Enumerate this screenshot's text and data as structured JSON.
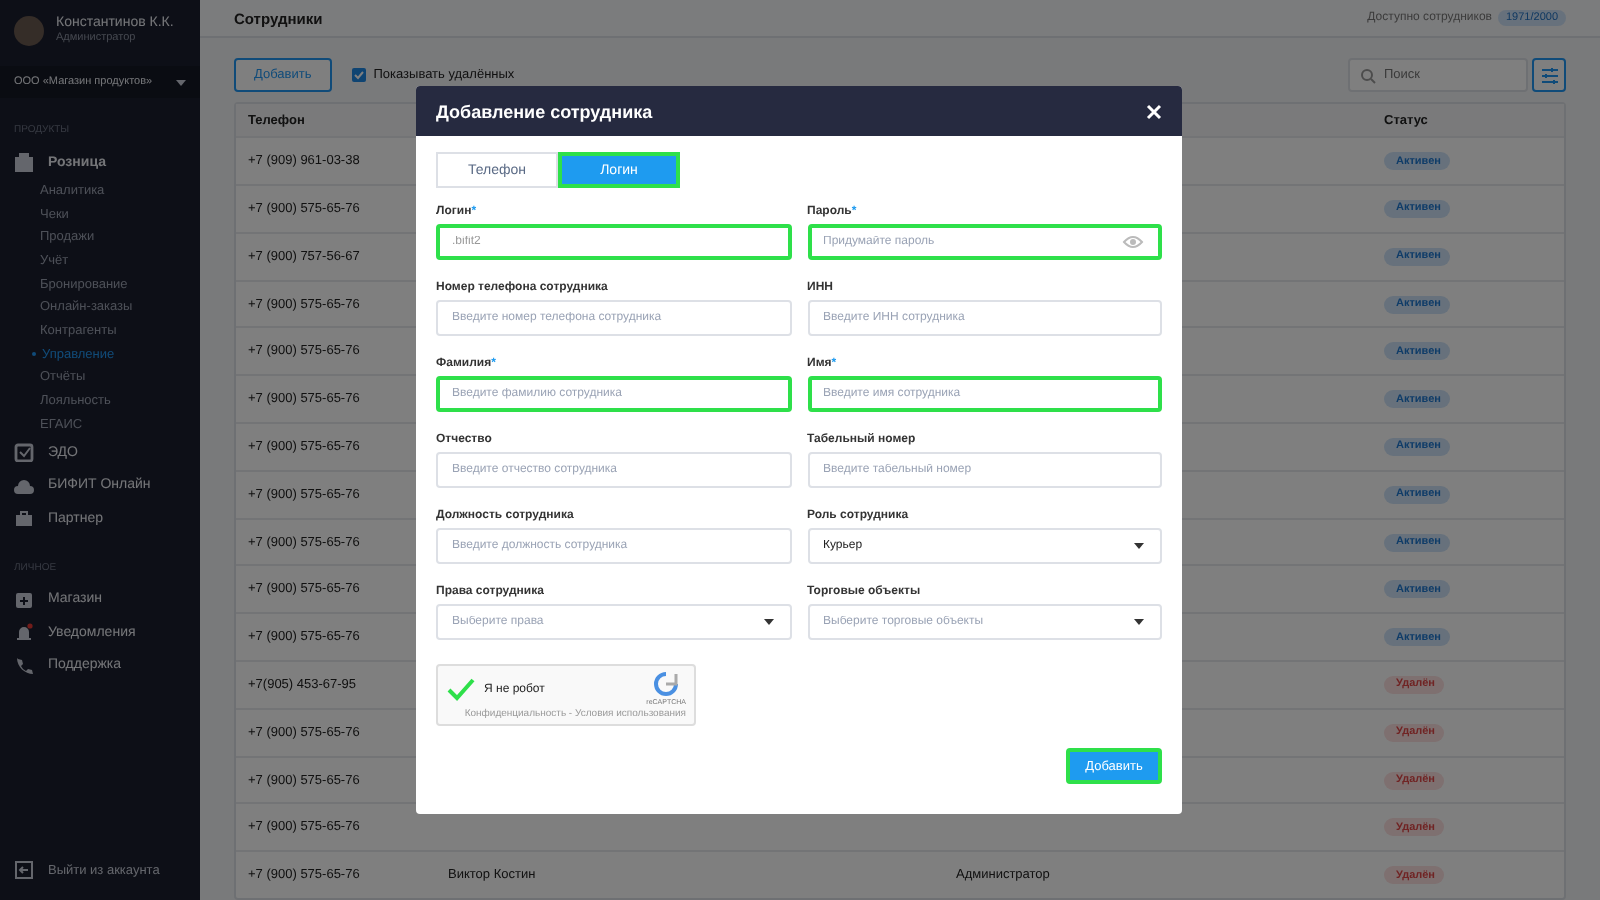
{
  "sidebar": {
    "user": {
      "name": "Константинов К.К.",
      "role": "Администратор"
    },
    "company": "ООО «Магазин продуктов»",
    "sections": [
      {
        "title": "ПРОДУКТЫ",
        "items": [
          {
            "label": "Розница",
            "expanded": true,
            "children": [
              {
                "label": "Аналитика",
                "selected": false
              },
              {
                "label": "Чеки",
                "selected": false
              },
              {
                "label": "Продажи",
                "selected": false
              },
              {
                "label": "Учёт",
                "selected": false
              },
              {
                "label": "Бронирование",
                "selected": false
              },
              {
                "label": "Онлайн-заказы",
                "selected": false
              },
              {
                "label": "Контрагенты",
                "selected": false
              },
              {
                "label": "Управление",
                "selected": true
              },
              {
                "label": "Отчёты",
                "selected": false
              },
              {
                "label": "Лояльность",
                "selected": false
              },
              {
                "label": "ЕГАИС",
                "selected": false
              }
            ]
          },
          {
            "label": "ЭДО",
            "expanded": false
          },
          {
            "label": "БИФИТ Онлайн",
            "expanded": false
          },
          {
            "label": "Партнер",
            "expanded": false
          }
        ]
      },
      {
        "title": "ЛИЧНОЕ",
        "items": [
          {
            "label": "Магазин",
            "expanded": false
          },
          {
            "label": "Уведомления",
            "expanded": false
          },
          {
            "label": "Поддержка",
            "expanded": false
          }
        ]
      }
    ],
    "logout": "Выйти из аккаунта"
  },
  "page": {
    "title": "Сотрудники",
    "available_label": "Доступно сотрудников",
    "available_count": "1971/2000"
  },
  "toolbar": {
    "add_button": "Добавить",
    "show_deleted": {
      "label": "Показывать удалённых",
      "checked": true
    },
    "search": {
      "placeholder": "Поиск"
    }
  },
  "table": {
    "columns": [
      "Телефон",
      "Статус"
    ],
    "rows": [
      {
        "phone": "+7 (909) 961-03-38",
        "status": "Активен",
        "kind": "active"
      },
      {
        "phone": "+7 (900) 575-65-76",
        "status": "Активен",
        "kind": "active"
      },
      {
        "phone": "+7 (900) 757-56-67",
        "status": "Активен",
        "kind": "active"
      },
      {
        "phone": "+7 (900) 575-65-76",
        "status": "Активен",
        "kind": "active"
      },
      {
        "phone": "+7 (900) 575-65-76",
        "status": "Активен",
        "kind": "active"
      },
      {
        "phone": "+7 (900) 575-65-76",
        "status": "Активен",
        "kind": "active"
      },
      {
        "phone": "+7 (900) 575-65-76",
        "status": "Активен",
        "kind": "active"
      },
      {
        "phone": "+7 (900) 575-65-76",
        "status": "Активен",
        "kind": "active"
      },
      {
        "phone": "+7 (900) 575-65-76",
        "status": "Активен",
        "kind": "active"
      },
      {
        "phone": "+7 (900) 575-65-76",
        "status": "Активен",
        "kind": "active"
      },
      {
        "phone": "+7 (900) 575-65-76",
        "status": "Активен",
        "kind": "active"
      },
      {
        "phone": "+7(905) 453-67-95",
        "status": "Удалён",
        "kind": "deleted"
      },
      {
        "phone": "+7 (900) 575-65-76",
        "status": "Удалён",
        "kind": "deleted"
      },
      {
        "phone": "+7 (900) 575-65-76",
        "status": "Удалён",
        "kind": "deleted"
      },
      {
        "phone": "+7 (900) 575-65-76",
        "status": "Удалён",
        "kind": "deleted"
      },
      {
        "phone": "+7 (900) 575-65-76",
        "name": "Виктор Костин",
        "role": "Администратор",
        "status": "Удалён",
        "kind": "deleted"
      }
    ]
  },
  "modal": {
    "title": "Добавление сотрудника",
    "tabs": [
      {
        "label": "Телефон",
        "selected": false,
        "highlighted": false
      },
      {
        "label": "Логин",
        "selected": true,
        "highlighted": true
      }
    ],
    "fields": [
      {
        "label": "Логин",
        "mark": "*",
        "kind": "text",
        "value": ".bifit2",
        "highlighted": true
      },
      {
        "label": "Пароль",
        "mark": "*",
        "kind": "password",
        "placeholder": "Придумайте пароль",
        "highlighted": true
      },
      {
        "label": "Номер телефона сотрудника",
        "kind": "text",
        "placeholder": "Введите номер телефона сотрудника",
        "highlighted": false
      },
      {
        "label": "ИНН",
        "kind": "text",
        "placeholder": "Введите ИНН сотрудника",
        "highlighted": false
      },
      {
        "label": "Фамилия",
        "mark": "*",
        "kind": "text",
        "placeholder": "Введите фамилию сотрудника",
        "highlighted": true
      },
      {
        "label": "Имя",
        "mark": "*",
        "kind": "text",
        "placeholder": "Введите имя сотрудника",
        "highlighted": true
      },
      {
        "label": "Отчество",
        "kind": "text",
        "placeholder": "Введите отчество сотрудника",
        "highlighted": false
      },
      {
        "label": "Табельный номер",
        "kind": "text",
        "placeholder": "Введите табельный номер",
        "highlighted": false
      },
      {
        "label": "Должность сотрудника",
        "kind": "text",
        "placeholder": "Введите должность сотрудника",
        "highlighted": false
      },
      {
        "label": "Роль сотрудника",
        "kind": "select",
        "value": "Курьер",
        "highlighted": false
      },
      {
        "label": "Права сотрудника",
        "kind": "select",
        "placeholder": "Выберите права",
        "highlighted": false
      },
      {
        "label": "Торговые объекты",
        "kind": "select",
        "placeholder": "Выберите торговые объекты",
        "highlighted": false
      }
    ],
    "captcha": {
      "label": "Я не робот",
      "checked": true,
      "brand": "reCAPTCHA",
      "footer": "Конфиденциальность - Условия использования"
    },
    "submit": {
      "label": "Добавить",
      "highlighted": true
    }
  }
}
